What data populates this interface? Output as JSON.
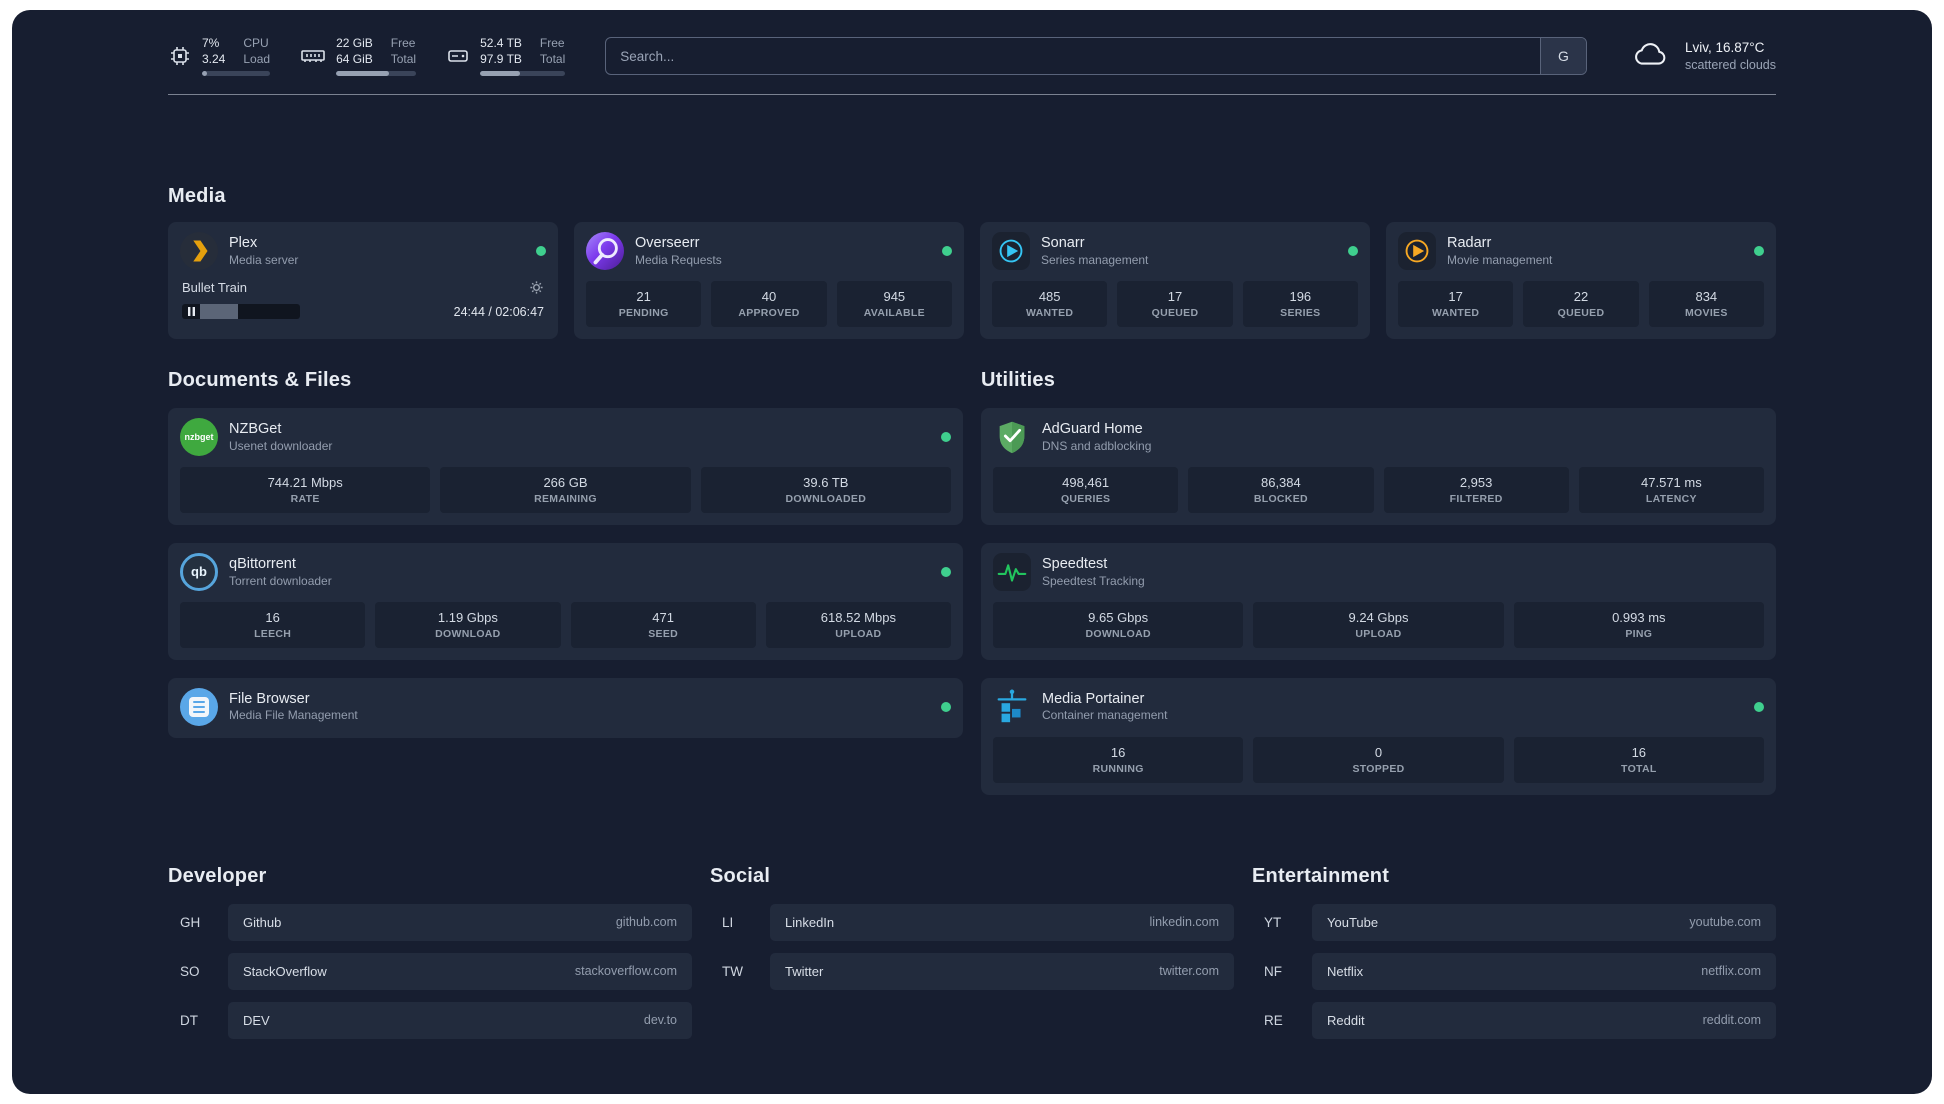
{
  "topbar": {
    "cpu": {
      "line1_value": "7%",
      "line1_label": "CPU",
      "line2_value": "3.24",
      "line2_label": "Load",
      "bar_pct": 8
    },
    "memory": {
      "line1_value": "22 GiB",
      "line1_label": "Free",
      "line2_value": "64 GiB",
      "line2_label": "Total",
      "bar_pct": 66
    },
    "disk": {
      "line1_value": "52.4 TB",
      "line1_label": "Free",
      "line2_value": "97.9 TB",
      "line2_label": "Total",
      "bar_pct": 47
    },
    "search": {
      "placeholder": "Search...",
      "provider": "G"
    },
    "weather": {
      "location": "Lviv, 16.87°C",
      "condition": "scattered clouds"
    }
  },
  "media": {
    "title": "Media",
    "plex": {
      "name": "Plex",
      "desc": "Media server",
      "track": "Bullet Train",
      "time": "24:44 / 02:06:47",
      "progress_pct": 32
    },
    "overseerr": {
      "name": "Overseerr",
      "desc": "Media Requests",
      "stats": [
        {
          "value": "21",
          "label": "PENDING"
        },
        {
          "value": "40",
          "label": "APPROVED"
        },
        {
          "value": "945",
          "label": "AVAILABLE"
        }
      ]
    },
    "sonarr": {
      "name": "Sonarr",
      "desc": "Series management",
      "stats": [
        {
          "value": "485",
          "label": "WANTED"
        },
        {
          "value": "17",
          "label": "QUEUED"
        },
        {
          "value": "196",
          "label": "SERIES"
        }
      ]
    },
    "radarr": {
      "name": "Radarr",
      "desc": "Movie management",
      "stats": [
        {
          "value": "17",
          "label": "WANTED"
        },
        {
          "value": "22",
          "label": "QUEUED"
        },
        {
          "value": "834",
          "label": "MOVIES"
        }
      ]
    }
  },
  "documents": {
    "title": "Documents & Files",
    "nzbget": {
      "name": "NZBGet",
      "desc": "Usenet downloader",
      "icon_text": "nzbget",
      "stats": [
        {
          "value": "744.21 Mbps",
          "label": "RATE"
        },
        {
          "value": "266 GB",
          "label": "REMAINING"
        },
        {
          "value": "39.6 TB",
          "label": "DOWNLOADED"
        }
      ]
    },
    "qbittorrent": {
      "name": "qBittorrent",
      "desc": "Torrent downloader",
      "icon_text": "qb",
      "stats": [
        {
          "value": "16",
          "label": "LEECH"
        },
        {
          "value": "1.19 Gbps",
          "label": "DOWNLOAD"
        },
        {
          "value": "471",
          "label": "SEED"
        },
        {
          "value": "618.52 Mbps",
          "label": "UPLOAD"
        }
      ]
    },
    "filebrowser": {
      "name": "File Browser",
      "desc": "Media File Management"
    }
  },
  "utilities": {
    "title": "Utilities",
    "adguard": {
      "name": "AdGuard Home",
      "desc": "DNS and adblocking",
      "stats": [
        {
          "value": "498,461",
          "label": "QUERIES"
        },
        {
          "value": "86,384",
          "label": "BLOCKED"
        },
        {
          "value": "2,953",
          "label": "FILTERED"
        },
        {
          "value": "47.571 ms",
          "label": "LATENCY"
        }
      ]
    },
    "speedtest": {
      "name": "Speedtest",
      "desc": "Speedtest Tracking",
      "stats": [
        {
          "value": "9.65 Gbps",
          "label": "DOWNLOAD"
        },
        {
          "value": "9.24 Gbps",
          "label": "UPLOAD"
        },
        {
          "value": "0.993 ms",
          "label": "PING"
        }
      ]
    },
    "portainer": {
      "name": "Media Portainer",
      "desc": "Container management",
      "stats": [
        {
          "value": "16",
          "label": "RUNNING"
        },
        {
          "value": "0",
          "label": "STOPPED"
        },
        {
          "value": "16",
          "label": "TOTAL"
        }
      ]
    }
  },
  "bookmarks": {
    "developer": {
      "title": "Developer",
      "items": [
        {
          "abbr": "GH",
          "name": "Github",
          "url": "github.com"
        },
        {
          "abbr": "SO",
          "name": "StackOverflow",
          "url": "stackoverflow.com"
        },
        {
          "abbr": "DT",
          "name": "DEV",
          "url": "dev.to"
        }
      ]
    },
    "social": {
      "title": "Social",
      "items": [
        {
          "abbr": "LI",
          "name": "LinkedIn",
          "url": "linkedin.com"
        },
        {
          "abbr": "TW",
          "name": "Twitter",
          "url": "twitter.com"
        }
      ]
    },
    "entertainment": {
      "title": "Entertainment",
      "items": [
        {
          "abbr": "YT",
          "name": "YouTube",
          "url": "youtube.com"
        },
        {
          "abbr": "NF",
          "name": "Netflix",
          "url": "netflix.com"
        },
        {
          "abbr": "RE",
          "name": "Reddit",
          "url": "reddit.com"
        }
      ]
    }
  }
}
